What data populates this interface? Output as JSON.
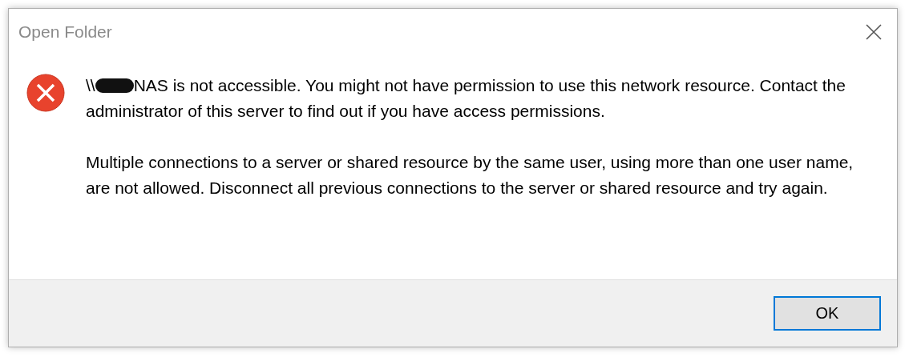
{
  "window": {
    "title": "Open Folder"
  },
  "message": {
    "paragraphs": [
      {
        "prefix": "\\\\",
        "redacted": true,
        "text": "NAS is not accessible. You might not have permission to use this network resource. Contact the administrator of this server to find out if you have access permissions."
      },
      {
        "redacted": false,
        "text": "Multiple connections to a server or shared resource by the same user, using more than one user name, are not allowed. Disconnect all previous connections to the server or shared resource and try again."
      }
    ]
  },
  "buttons": [
    {
      "label": "OK",
      "selected": true
    }
  ]
}
